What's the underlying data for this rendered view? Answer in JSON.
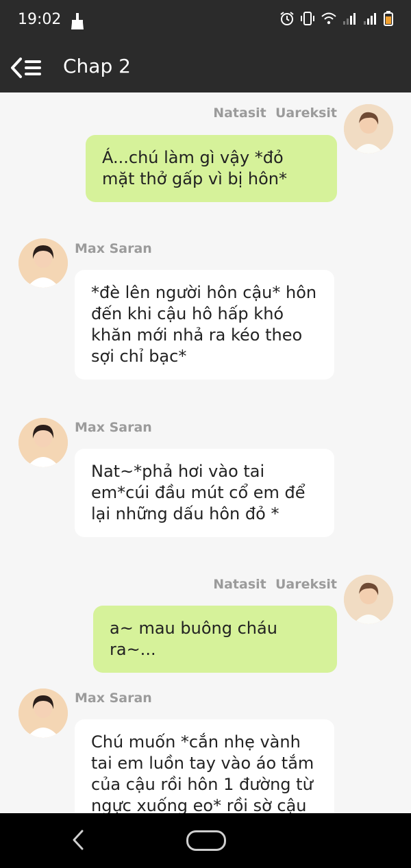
{
  "status_bar": {
    "time": "19:02",
    "icons": [
      "broom-icon",
      "alarm-icon",
      "vibrate-icon",
      "wifi-icon",
      "signal-icon",
      "signal-icon",
      "battery-icon"
    ]
  },
  "app_bar": {
    "back_icon": "back-menu-icon",
    "title": "Chap 2"
  },
  "messages": [
    {
      "sender": "Natasit  Uareksit",
      "side": "right",
      "text": "Á...chú làm gì vậy *đỏ mặt thở gấp vì bị hôn*"
    },
    {
      "sender": "Max Saran",
      "side": "left",
      "text": "*đè lên người hôn cậu* hôn đến khi cậu hô hấp khó khăn mới nhả ra kéo theo sợi chỉ bạc*"
    },
    {
      "sender": "Max Saran",
      "side": "left",
      "text": "Nat~*phả hơi vào tai em*cúi đầu mút cổ em để lại những dấu hôn đỏ *"
    },
    {
      "sender": "Natasit  Uareksit",
      "side": "right",
      "text": "a~ mau buông cháu ra~..."
    },
    {
      "sender": "Max Saran",
      "side": "left",
      "text": "Chú muốn *cắn nhẹ vành tai em luồn tay vào áo tắm của cậu rồi hôn 1 đường từ ngực xuống eo* rồi sờ cậu"
    }
  ],
  "nav_bar": {
    "icons": [
      "back-icon",
      "home-icon"
    ]
  },
  "colors": {
    "top_bar": "#2b2b2b",
    "chat_background": "#f6f6f6",
    "my_bubble": "#d6f29a",
    "other_bubble": "#ffffff",
    "sender_text": "#9b9b9b"
  }
}
